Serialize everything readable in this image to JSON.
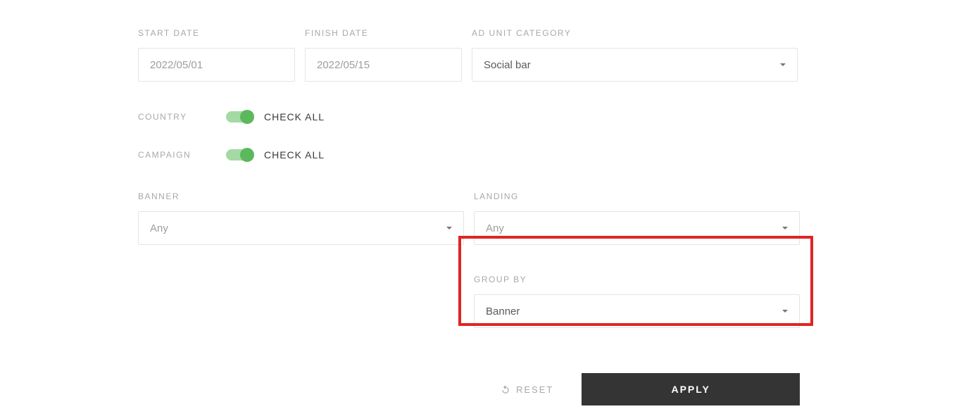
{
  "form": {
    "start_date": {
      "label": "START DATE",
      "placeholder": "2022/05/01"
    },
    "finish_date": {
      "label": "FINISH DATE",
      "placeholder": "2022/05/15"
    },
    "ad_unit_category": {
      "label": "AD UNIT CATEGORY",
      "value": "Social bar"
    },
    "country": {
      "label": "COUNTRY",
      "toggle_text": "CHECK ALL"
    },
    "campaign": {
      "label": "CAMPAIGN",
      "toggle_text": "CHECK ALL"
    },
    "banner": {
      "label": "BANNER",
      "value": "Any"
    },
    "landing": {
      "label": "LANDING",
      "value": "Any"
    },
    "group_by": {
      "label": "GROUP BY",
      "value": "Banner"
    }
  },
  "actions": {
    "reset": "RESET",
    "apply": "APPLY"
  }
}
